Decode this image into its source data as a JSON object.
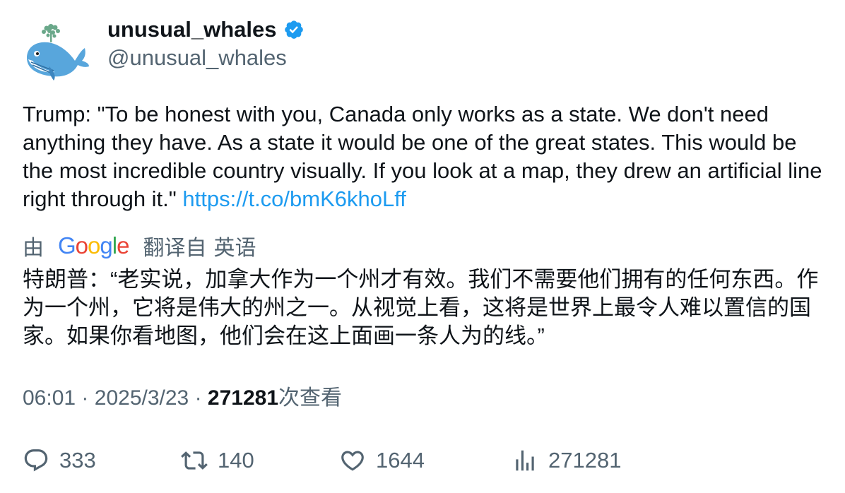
{
  "author": {
    "display_name": "unusual_whales",
    "handle": "@unusual_whales",
    "verified": true,
    "verified_color": "#1d9bf0",
    "avatar_icon": "whale-avatar"
  },
  "tweet": {
    "text": "Trump: \"To be honest with you, Canada only works as a state. We don't need anything they have. As a state it would be one of the great states. This would be the most incredible country visually. If you look at a map, they drew an artificial line right through it.\" ",
    "link": "https://t.co/bmK6khoLff",
    "link_color": "#1d9bf0"
  },
  "translation": {
    "by_label": "由",
    "provider": "Google",
    "from_label": "翻译自",
    "language": "英语",
    "text": "特朗普：“老实说，加拿大作为一个州才有效。我们不需要他们拥有的任何东西。作为一个州，它将是伟大的州之一。从视觉上看，这将是世界上最令人难以置信的国家。如果你看地图，他们会在这上面画一条人为的线。”"
  },
  "meta": {
    "time": "06:01",
    "separator": "·",
    "date": "2025/3/23",
    "views_count": "271281",
    "views_label": "次查看"
  },
  "actions": {
    "replies": "333",
    "retweets": "140",
    "likes": "1644",
    "views": "271281"
  },
  "colors": {
    "text_primary": "#0f1419",
    "text_secondary": "#536471",
    "accent": "#1d9bf0"
  }
}
